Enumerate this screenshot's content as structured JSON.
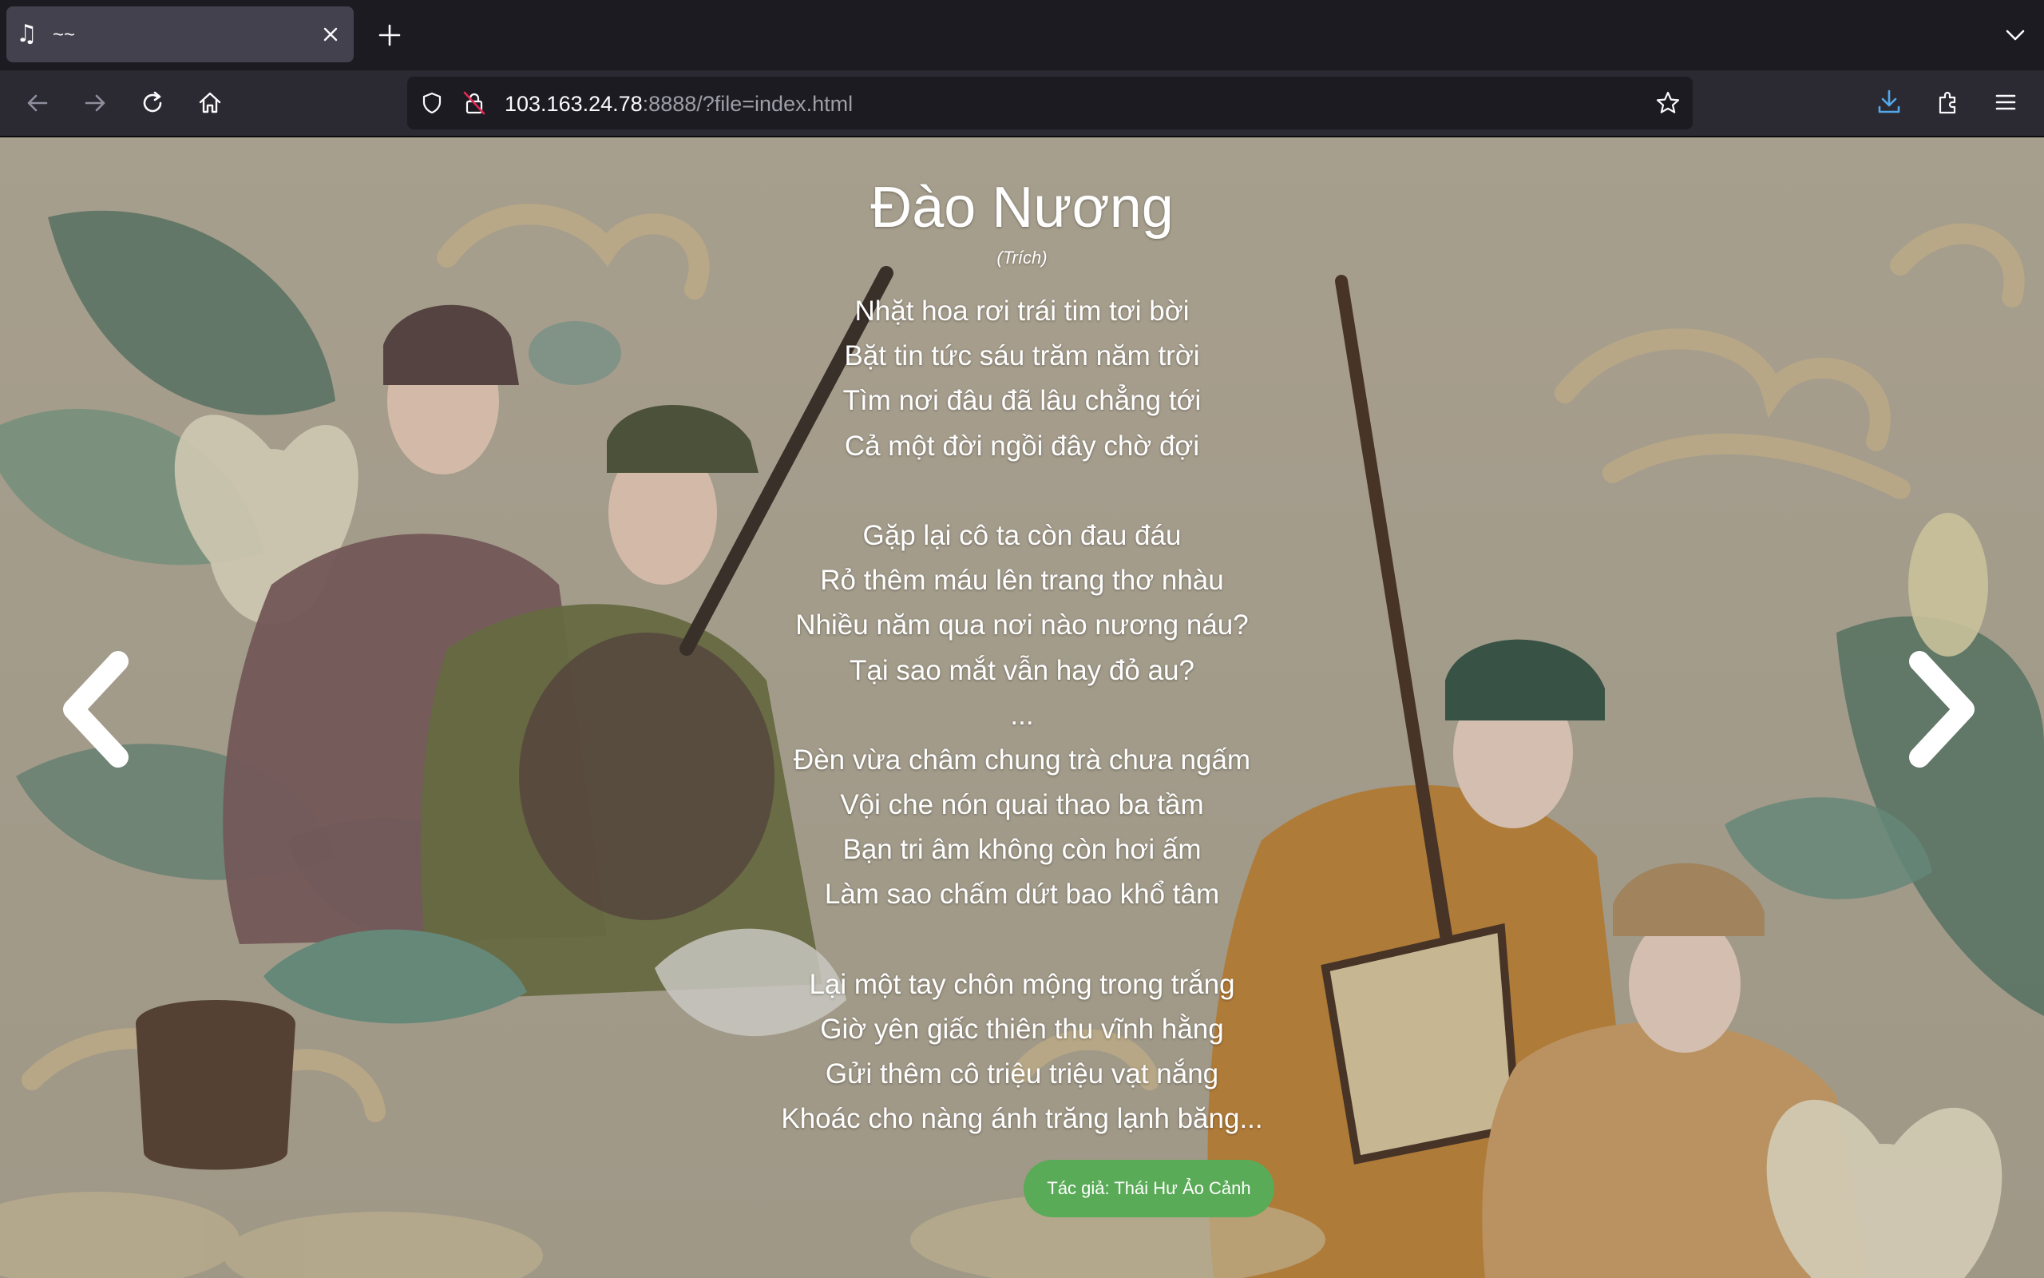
{
  "browser": {
    "tab": {
      "icon": "music-note-icon",
      "icon_glyph": "♫",
      "title": "~~"
    },
    "url": {
      "host": "103.163.24.78",
      "rest": ":8888/?file=index.html"
    }
  },
  "poem": {
    "title": "Đào Nương",
    "subtitle": "(Trích)",
    "lines": [
      "Nhặt hoa rơi trái tim tơi bời",
      "Bặt tin tức sáu trăm năm trời",
      "Tìm nơi đâu đã lâu chẳng tới",
      "Cả một đời ngồi đây chờ đợi",
      "",
      "Gặp lại cô ta còn đau đáu",
      "Rỏ thêm máu lên trang thơ nhàu",
      "Nhiều năm qua nơi nào nương náu?",
      "Tại sao mắt vẫn hay đỏ au?",
      "...",
      "Đèn vừa châm chung trà chưa ngấm",
      "Vội che nón quai thao ba tầm",
      "Bạn tri âm không còn hơi ấm",
      "Làm sao chấm dứt bao khổ tâm",
      "",
      "Lại một tay chôn mộng trong trắng",
      "Giờ yên giấc thiên thu vĩnh hằng",
      "Gửi thêm cô triệu triệu vạt nắng",
      "Khoác cho nàng ánh trăng lạnh băng..."
    ],
    "author_button": "Tác giả: Thái Hư Ảo Cảnh"
  },
  "colors": {
    "author_button": "#5aab57",
    "browser_bg": "#1c1b22",
    "toolbar_bg": "#2b2a33",
    "download_accent": "#54a7e8"
  }
}
